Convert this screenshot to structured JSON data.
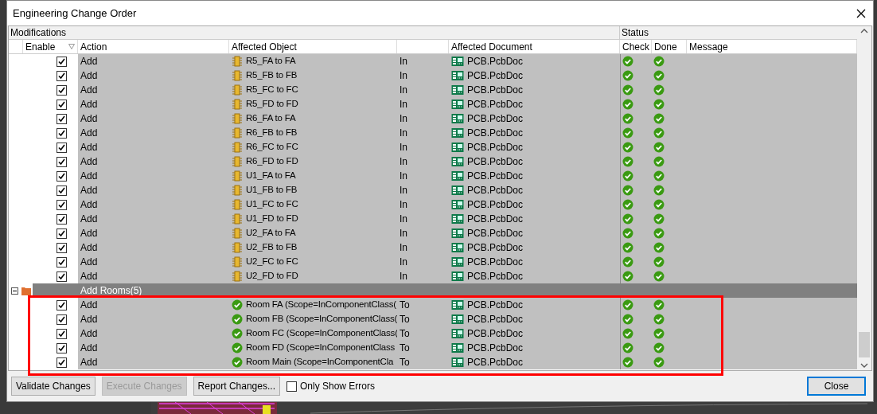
{
  "window": {
    "title": "Engineering Change Order"
  },
  "table": {
    "group_header": "Modifications",
    "status_header": "Status",
    "columns": [
      {
        "label": "Enable",
        "filter": true
      },
      {
        "label": "Action"
      },
      {
        "label": "Affected Object"
      },
      {
        "label": "Affected Document"
      },
      {
        "label": "Check"
      },
      {
        "label": "Done"
      },
      {
        "label": "Message"
      }
    ],
    "rows": [
      {
        "kind": "item",
        "enabled": true,
        "action": "Add",
        "object": {
          "kind": "component",
          "text": "R5_FA to FA"
        },
        "direction": "In",
        "document": "PCB.PcbDoc",
        "check": true,
        "done": true
      },
      {
        "kind": "item",
        "enabled": true,
        "action": "Add",
        "object": {
          "kind": "component",
          "text": "R5_FB to FB"
        },
        "direction": "In",
        "document": "PCB.PcbDoc",
        "check": true,
        "done": true
      },
      {
        "kind": "item",
        "enabled": true,
        "action": "Add",
        "object": {
          "kind": "component",
          "text": "R5_FC to FC"
        },
        "direction": "In",
        "document": "PCB.PcbDoc",
        "check": true,
        "done": true
      },
      {
        "kind": "item",
        "enabled": true,
        "action": "Add",
        "object": {
          "kind": "component",
          "text": "R5_FD to FD"
        },
        "direction": "In",
        "document": "PCB.PcbDoc",
        "check": true,
        "done": true
      },
      {
        "kind": "item",
        "enabled": true,
        "action": "Add",
        "object": {
          "kind": "component",
          "text": "R6_FA to FA"
        },
        "direction": "In",
        "document": "PCB.PcbDoc",
        "check": true,
        "done": true
      },
      {
        "kind": "item",
        "enabled": true,
        "action": "Add",
        "object": {
          "kind": "component",
          "text": "R6_FB to FB"
        },
        "direction": "In",
        "document": "PCB.PcbDoc",
        "check": true,
        "done": true
      },
      {
        "kind": "item",
        "enabled": true,
        "action": "Add",
        "object": {
          "kind": "component",
          "text": "R6_FC to FC"
        },
        "direction": "In",
        "document": "PCB.PcbDoc",
        "check": true,
        "done": true
      },
      {
        "kind": "item",
        "enabled": true,
        "action": "Add",
        "object": {
          "kind": "component",
          "text": "R6_FD to FD"
        },
        "direction": "In",
        "document": "PCB.PcbDoc",
        "check": true,
        "done": true
      },
      {
        "kind": "item",
        "enabled": true,
        "action": "Add",
        "object": {
          "kind": "component",
          "text": "U1_FA to FA"
        },
        "direction": "In",
        "document": "PCB.PcbDoc",
        "check": true,
        "done": true
      },
      {
        "kind": "item",
        "enabled": true,
        "action": "Add",
        "object": {
          "kind": "component",
          "text": "U1_FB to FB"
        },
        "direction": "In",
        "document": "PCB.PcbDoc",
        "check": true,
        "done": true
      },
      {
        "kind": "item",
        "enabled": true,
        "action": "Add",
        "object": {
          "kind": "component",
          "text": "U1_FC to FC"
        },
        "direction": "In",
        "document": "PCB.PcbDoc",
        "check": true,
        "done": true
      },
      {
        "kind": "item",
        "enabled": true,
        "action": "Add",
        "object": {
          "kind": "component",
          "text": "U1_FD to FD"
        },
        "direction": "In",
        "document": "PCB.PcbDoc",
        "check": true,
        "done": true
      },
      {
        "kind": "item",
        "enabled": true,
        "action": "Add",
        "object": {
          "kind": "component",
          "text": "U2_FA to FA"
        },
        "direction": "In",
        "document": "PCB.PcbDoc",
        "check": true,
        "done": true
      },
      {
        "kind": "item",
        "enabled": true,
        "action": "Add",
        "object": {
          "kind": "component",
          "text": "U2_FB to FB"
        },
        "direction": "In",
        "document": "PCB.PcbDoc",
        "check": true,
        "done": true
      },
      {
        "kind": "item",
        "enabled": true,
        "action": "Add",
        "object": {
          "kind": "component",
          "text": "U2_FC to FC"
        },
        "direction": "In",
        "document": "PCB.PcbDoc",
        "check": true,
        "done": true
      },
      {
        "kind": "item",
        "enabled": true,
        "action": "Add",
        "object": {
          "kind": "component",
          "text": "U2_FD to FD"
        },
        "direction": "In",
        "document": "PCB.PcbDoc",
        "check": true,
        "done": true
      },
      {
        "kind": "group",
        "label": "Add Rooms(5)",
        "expanded": true
      },
      {
        "kind": "item",
        "enabled": true,
        "action": "Add",
        "object": {
          "kind": "room",
          "text": "Room FA (Scope=InComponentClass("
        },
        "direction": "To",
        "document": "PCB.PcbDoc",
        "check": true,
        "done": true
      },
      {
        "kind": "item",
        "enabled": true,
        "action": "Add",
        "object": {
          "kind": "room",
          "text": "Room FB (Scope=InComponentClass("
        },
        "direction": "To",
        "document": "PCB.PcbDoc",
        "check": true,
        "done": true
      },
      {
        "kind": "item",
        "enabled": true,
        "action": "Add",
        "object": {
          "kind": "room",
          "text": "Room FC (Scope=InComponentClass("
        },
        "direction": "To",
        "document": "PCB.PcbDoc",
        "check": true,
        "done": true
      },
      {
        "kind": "item",
        "enabled": true,
        "action": "Add",
        "object": {
          "kind": "room",
          "text": "Room FD (Scope=InComponentClass"
        },
        "direction": "To",
        "document": "PCB.PcbDoc",
        "check": true,
        "done": true
      },
      {
        "kind": "item",
        "enabled": true,
        "action": "Add",
        "object": {
          "kind": "room",
          "text": "Room Main (Scope=InComponentCla"
        },
        "direction": "To",
        "document": "PCB.PcbDoc",
        "check": true,
        "done": true
      }
    ]
  },
  "buttons": [
    {
      "label": "Validate Changes",
      "disabled": false
    },
    {
      "label": "Execute Changes",
      "disabled": true
    },
    {
      "label": "Report Changes...",
      "disabled": false
    }
  ],
  "only_show_errors": {
    "label": "Only Show Errors",
    "checked": false
  },
  "close_button": {
    "label": "Close",
    "default": true
  }
}
